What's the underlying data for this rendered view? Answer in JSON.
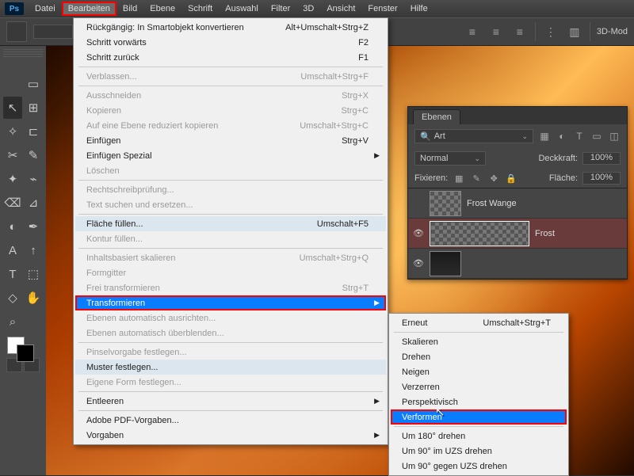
{
  "app_icon": "Ps",
  "menubar": [
    "Datei",
    "Bearbeiten",
    "Bild",
    "Ebene",
    "Schrift",
    "Auswahl",
    "Filter",
    "3D",
    "Ansicht",
    "Fenster",
    "Hilfe"
  ],
  "menubar_active_index": 1,
  "optionsbar": {
    "mode_label": "3D-Mod"
  },
  "edit_menu": {
    "groups": [
      [
        {
          "label": "Rückgängig: In Smartobjekt konvertieren",
          "shortcut": "Alt+Umschalt+Strg+Z"
        },
        {
          "label": "Schritt vorwärts",
          "shortcut": "F2"
        },
        {
          "label": "Schritt zurück",
          "shortcut": "F1"
        }
      ],
      [
        {
          "label": "Verblassen...",
          "shortcut": "Umschalt+Strg+F",
          "disabled": true
        }
      ],
      [
        {
          "label": "Ausschneiden",
          "shortcut": "Strg+X",
          "disabled": true
        },
        {
          "label": "Kopieren",
          "shortcut": "Strg+C",
          "disabled": true
        },
        {
          "label": "Auf eine Ebene reduziert kopieren",
          "shortcut": "Umschalt+Strg+C",
          "disabled": true
        },
        {
          "label": "Einfügen",
          "shortcut": "Strg+V"
        },
        {
          "label": "Einfügen Spezial",
          "shortcut": "",
          "submenu": true
        },
        {
          "label": "Löschen",
          "shortcut": "",
          "disabled": true
        }
      ],
      [
        {
          "label": "Rechtschreibprüfung...",
          "shortcut": "",
          "disabled": true
        },
        {
          "label": "Text suchen und ersetzen...",
          "shortcut": "",
          "disabled": true
        }
      ],
      [
        {
          "label": "Fläche füllen...",
          "shortcut": "Umschalt+F5",
          "tint": true
        },
        {
          "label": "Kontur füllen...",
          "shortcut": "",
          "disabled": true
        }
      ],
      [
        {
          "label": "Inhaltsbasiert skalieren",
          "shortcut": "Umschalt+Strg+Q",
          "disabled": true
        },
        {
          "label": "Formgitter",
          "shortcut": "",
          "disabled": true
        },
        {
          "label": "Frei transformieren",
          "shortcut": "Strg+T",
          "disabled": true
        },
        {
          "label": "Transformieren",
          "shortcut": "",
          "submenu": true,
          "highlight": true,
          "red": true
        },
        {
          "label": "Ebenen automatisch ausrichten...",
          "shortcut": "",
          "disabled": true
        },
        {
          "label": "Ebenen automatisch überblenden...",
          "shortcut": "",
          "disabled": true
        }
      ],
      [
        {
          "label": "Pinselvorgabe festlegen...",
          "shortcut": "",
          "disabled": true
        },
        {
          "label": "Muster festlegen...",
          "shortcut": "",
          "tint": true
        },
        {
          "label": "Eigene Form festlegen...",
          "shortcut": "",
          "disabled": true
        }
      ],
      [
        {
          "label": "Entleeren",
          "shortcut": "",
          "submenu": true
        }
      ],
      [
        {
          "label": "Adobe PDF-Vorgaben...",
          "shortcut": ""
        },
        {
          "label": "Vorgaben",
          "shortcut": "",
          "submenu": true
        }
      ]
    ]
  },
  "transform_submenu": {
    "groups": [
      [
        {
          "label": "Erneut",
          "shortcut": "Umschalt+Strg+T"
        }
      ],
      [
        {
          "label": "Skalieren"
        },
        {
          "label": "Drehen"
        },
        {
          "label": "Neigen"
        },
        {
          "label": "Verzerren"
        },
        {
          "label": "Perspektivisch"
        },
        {
          "label": "Verformen",
          "highlight": true,
          "red": true
        }
      ],
      [
        {
          "label": "Um 180° drehen"
        },
        {
          "label": "Um 90° im UZS drehen"
        },
        {
          "label": "Um 90° gegen UZS drehen"
        }
      ]
    ]
  },
  "layers_panel": {
    "tab": "Ebenen",
    "kind_label": "Art",
    "blend_mode": "Normal",
    "opacity_label": "Deckkraft:",
    "opacity_value": "100%",
    "lock_label": "Fixieren:",
    "fill_label": "Fläche:",
    "fill_value": "100%",
    "layers": [
      {
        "name": "Frost Wange",
        "visible": false,
        "selected": false,
        "thumb": "checker"
      },
      {
        "name": "Frost",
        "visible": true,
        "selected": true,
        "thumb": "checker"
      },
      {
        "name": "",
        "visible": true,
        "selected": false,
        "thumb": "dark"
      }
    ]
  },
  "tools": [
    "▭",
    "↖",
    "⊞",
    "✧",
    "⊏",
    "✂",
    "✎",
    "✦",
    "⌁",
    "⌫",
    "⊿",
    "◐",
    "✒",
    "A",
    "↑",
    "T",
    "⬚",
    "◇",
    "✋",
    "⌕"
  ]
}
